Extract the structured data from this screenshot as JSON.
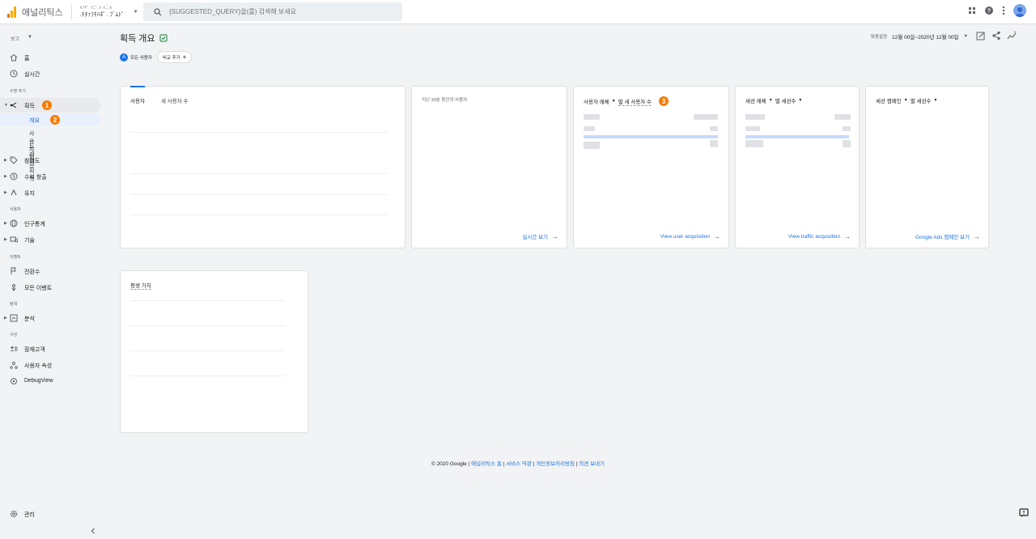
{
  "app": {
    "title": "애널리틱스",
    "account_line1": "ﾙｿﾔﾞ·ﾂﾆﾞ.ﾄ ﾄﾆ ﾙ",
    "account_line2": ".ﾁﾀｧﾌﾁﾊﾈﾟ. ﾌﾞﾑﾄﾟ",
    "search_placeholder": "{SUGGESTED_QUERY}을(를) 검색해 보세요"
  },
  "sidebar": {
    "report_selector": "보고",
    "sections": {
      "lifecycle": "수명 주기",
      "user": "사용자",
      "event": "이벤트",
      "explore": "탐색",
      "configure": "구성"
    },
    "items": {
      "home": "홈",
      "realtime": "실시간",
      "acquisition": "획득",
      "overview": "개요",
      "user_acquisition": "사용자 획득",
      "traffic_acquisition": "트래픽 획득",
      "engagement": "참여도",
      "monetization": "수익 창출",
      "retention": "유지",
      "demographics": "인구통계",
      "tech": "기술",
      "conversions": "전환수",
      "all_events": "모든 이벤트",
      "analysis": "분석",
      "audiences": "잠재고객",
      "user_properties": "사용자 속성",
      "debugview": "DebugView",
      "admin": "관리"
    },
    "badges": [
      "1",
      "2",
      "3"
    ]
  },
  "main": {
    "title": "획득 개요",
    "chip_all_users": "모든 사용자",
    "chip_compare": "비교 추가",
    "date_label": "맞춤설정",
    "date_value": "12월 00일~2020년 12월 00일",
    "cards": {
      "users_tab": "사용자",
      "new_users_tab": "새 사용자 수",
      "realtime_title": "지난 30분 동안의 사용자",
      "realtime_link": "실시간 보기",
      "ua_dim": "사용자 매체",
      "ua_by": "별 새 사용자 수",
      "ua_link": "View user acquisition",
      "ta_dim": "세션 매체",
      "ta_by": "별 세션수",
      "ta_link": "View traffic acquisition",
      "camp_dim": "세션 캠페인",
      "camp_by": "별 세션수",
      "camp_link": "Google Ads 캠페인 보기",
      "ltv_title": "평생 가치"
    }
  },
  "footer": {
    "copyright": "© 2020 Google",
    "home": "애널리틱스 홈",
    "terms": "서비스 약관",
    "privacy": "개인정보처리방침",
    "feedback": "의견 보내기"
  },
  "colors": {
    "accent": "#1a73e8",
    "badge": "#f57c00",
    "logo_orange": "#f9ab00",
    "logo_dark": "#e37400"
  }
}
